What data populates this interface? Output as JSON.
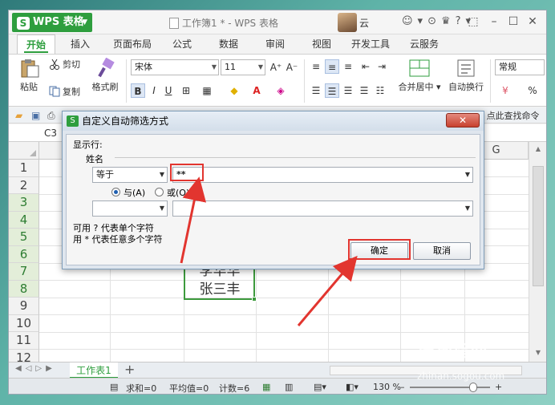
{
  "titlebar": {
    "app_name": "WPS 表格",
    "doc_title": "工作簿1 * - WPS 表格",
    "user": "云",
    "icons": [
      "☺",
      "▾",
      "⊙",
      "♛",
      "?",
      "▾"
    ]
  },
  "ribbon_tabs": [
    "开始",
    "插入",
    "页面布局",
    "公式",
    "数据",
    "审阅",
    "视图",
    "开发工具",
    "云服务"
  ],
  "ribbon": {
    "paste": "粘贴",
    "cut": "剪切",
    "copy": "复制",
    "format_painter": "格式刷",
    "font_name": "宋体",
    "font_size": "11",
    "merge_center": "合并居中",
    "wrap_text": "自动换行",
    "number_format": "常规",
    "percent": "%"
  },
  "quick_access": {
    "find_command": "点此查找命令"
  },
  "formula_bar": {
    "name_box": "C3"
  },
  "grid": {
    "columns": [
      "G"
    ],
    "rows": [
      "1",
      "2",
      "3",
      "4",
      "5",
      "6",
      "7",
      "8",
      "9",
      "10",
      "11",
      "12"
    ],
    "cells": {
      "c7": "李华华",
      "c8": "张三丰"
    }
  },
  "sheets": {
    "active": "工作表1"
  },
  "statusbar": {
    "sum": "求和=0",
    "average": "平均值=0",
    "count": "计数=6",
    "zoom": "130 %"
  },
  "dialog": {
    "title": "自定义自动筛选方式",
    "show_rows": "显示行:",
    "field": "姓名",
    "op1": "等于",
    "value1": "**",
    "and_label": "与(A)",
    "or_label": "或(O)",
    "op2": "",
    "value2": "",
    "hint1": "可用 ? 代表单个字符",
    "hint2": "用 * 代表任意多个字符",
    "ok": "确定",
    "cancel": "取消",
    "close": "✕"
  },
  "watermark": {
    "brand": "搜狗指南",
    "url": "zhinan.sogou.com"
  },
  "colors": {
    "wps_green": "#2e9e3e",
    "annotation_red": "#e2352f"
  }
}
